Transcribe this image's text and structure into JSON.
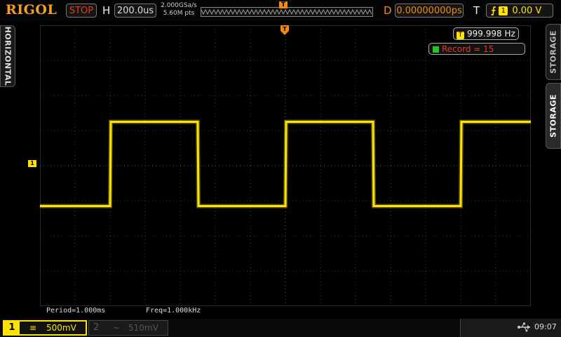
{
  "header": {
    "brand": "RIGOL",
    "run_state": "STOP",
    "horizontal_label": "H",
    "timebase": "200.0us",
    "sample_rate": "2.000GSa/s",
    "memory_depth": "5.60M pts",
    "trigger_marker": "T",
    "delay_label": "D",
    "delay_value": "0.00000000ps",
    "trigger_label": "T",
    "trigger_channel": "1",
    "trigger_level": "0.00 V"
  },
  "side_tabs": {
    "left": "HORIZONTAL",
    "right_top": "STORAGE",
    "right_active": "STORAGE"
  },
  "overlay": {
    "freq_channel": "T",
    "frequency": "999.998 Hz",
    "record": "Record = 15",
    "ch1_marker": "1"
  },
  "measurements": {
    "period": "Period=1.000ms",
    "freq": "Freq=1.000kHz"
  },
  "channels": [
    {
      "number": "1",
      "coupling": "≡",
      "scale": "500mV",
      "active": true
    },
    {
      "number": "2",
      "coupling": "~",
      "scale": "510mV",
      "active": false
    }
  ],
  "status": {
    "usb_icon": "usb-icon",
    "time": "09:07"
  },
  "colors": {
    "ch1": "#ffe300",
    "stop": "#e23a2a",
    "trigger": "#f08a10",
    "brand": "#f5a020"
  },
  "waveform": {
    "type": "square",
    "period_ms": 1.0,
    "high_div": 1.25,
    "low_div": -1.15,
    "start_phase": "low"
  }
}
